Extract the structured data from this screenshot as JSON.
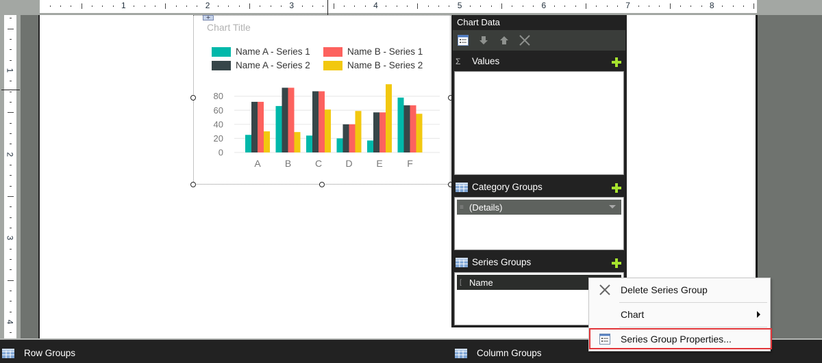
{
  "ruler": {
    "horizontal_labels": [
      "1",
      "2",
      "3",
      "4",
      "5",
      "6",
      "7",
      "8"
    ],
    "vertical_labels": [
      "1",
      "2",
      "3",
      "4"
    ]
  },
  "chart": {
    "tag_icon": "chart-anchor-icon",
    "title": "Chart Title",
    "legend": [
      {
        "label": "Name A - Series 1",
        "color": "#01b8aa"
      },
      {
        "label": "Name B - Series 1",
        "color": "#fd625e"
      },
      {
        "label": "Name A - Series 2",
        "color": "#374649"
      },
      {
        "label": "Name B - Series 2",
        "color": "#f2c80f"
      }
    ]
  },
  "chart_data": {
    "type": "bar",
    "title": "Chart Title",
    "xlabel": "",
    "ylabel": "",
    "categories": [
      "A",
      "B",
      "C",
      "D",
      "E",
      "F"
    ],
    "ylim": [
      0,
      100
    ],
    "yticks": [
      0,
      20,
      40,
      60,
      80
    ],
    "grid": true,
    "legend_position": "top-left",
    "series": [
      {
        "name": "Name A - Series 1",
        "color": "#01b8aa",
        "values": [
          25,
          66,
          24,
          20,
          17,
          78
        ]
      },
      {
        "name": "Name A - Series 2",
        "color": "#374649",
        "values": [
          72,
          92,
          87,
          40,
          57,
          67
        ]
      },
      {
        "name": "Name B - Series 1",
        "color": "#fd625e",
        "values": [
          72,
          92,
          87,
          40,
          57,
          67
        ]
      },
      {
        "name": "Name B - Series 2",
        "color": "#f2c80f",
        "values": [
          30,
          29,
          61,
          59,
          97,
          55
        ]
      }
    ]
  },
  "chart_data_panel": {
    "title": "Chart Data",
    "toolbar": [
      {
        "name": "properties-icon",
        "glyph": "properties"
      },
      {
        "name": "move-down-icon",
        "glyph": "⬇"
      },
      {
        "name": "move-up-icon",
        "glyph": "⬆"
      },
      {
        "name": "delete-icon",
        "glyph": "✕"
      }
    ],
    "values": {
      "label": "Values",
      "icon": "sigma-icon"
    },
    "category_groups": {
      "label": "Category Groups",
      "items": [
        "(Details)"
      ]
    },
    "series_groups": {
      "label": "Series Groups",
      "items": [
        "Name"
      ]
    }
  },
  "context_menu": {
    "items": [
      {
        "label": "Delete Series Group",
        "icon": "delete-icon"
      },
      {
        "label": "Chart",
        "has_submenu": true
      },
      {
        "label": "Series Group Properties...",
        "icon": "properties-icon",
        "highlighted": true
      }
    ],
    "highlight_color": "#e2363a"
  },
  "bottom_bar": {
    "row_groups": "Row Groups",
    "column_groups": "Column Groups"
  }
}
